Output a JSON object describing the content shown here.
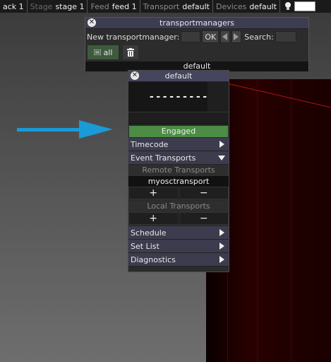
{
  "topbar": {
    "segments": [
      {
        "label": "",
        "value": "ack 1"
      },
      {
        "label": "Stage",
        "value": "stage 1"
      },
      {
        "label": "Feed",
        "value": "feed 1"
      },
      {
        "label": "Transport",
        "value": "default"
      },
      {
        "label": "Devices",
        "value": "default"
      }
    ],
    "icons": {
      "light": "lightbulb-icon",
      "swatch_color": "#ffffff"
    }
  },
  "transportmanagers": {
    "title": "transportmanagers",
    "new_label": "New transportmanager:",
    "ok_label": "OK",
    "search_label": "Search:",
    "search_value": "",
    "new_value": "",
    "all_label": "all",
    "selected": "default",
    "icons": {
      "close": "close-icon",
      "prev": "arrow-left-icon",
      "next": "arrow-right-icon",
      "all": "list-icon",
      "trash": "trash-icon"
    }
  },
  "default_panel": {
    "title": "default",
    "timecode": "---------",
    "engaged_label": "Engaged",
    "menu": {
      "timecode": "Timecode",
      "event_transports": "Event Transports",
      "schedule": "Schedule",
      "set_list": "Set List",
      "diagnostics": "Diagnostics"
    },
    "remote": {
      "heading": "Remote Transports",
      "items": [
        "myosctransport"
      ],
      "add": "+",
      "remove": "−"
    },
    "local": {
      "heading": "Local Transports",
      "add": "+",
      "remove": "−"
    }
  },
  "colors": {
    "engaged": "#4c8c44",
    "arrow": "#1a9ad6",
    "titlebar": "#45455e"
  }
}
